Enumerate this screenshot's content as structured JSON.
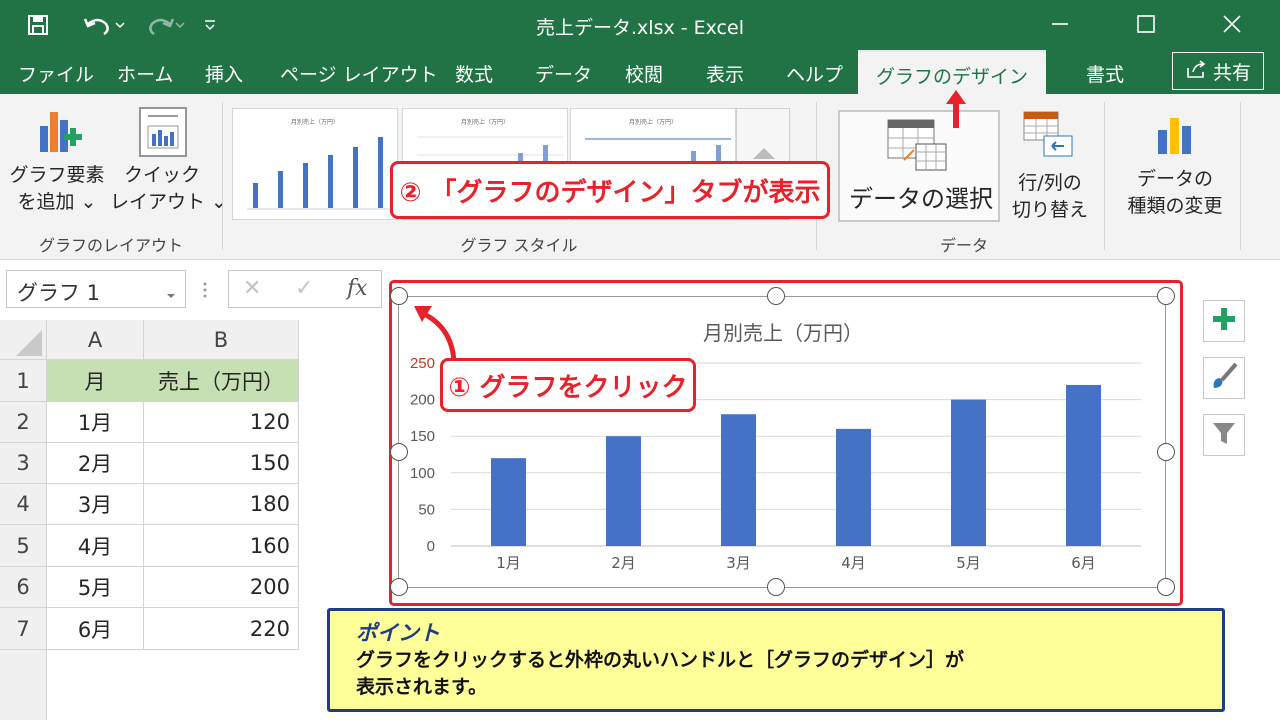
{
  "window": {
    "title": "売上データ.xlsx  -  Excel",
    "minimize_icon": "minimize-icon",
    "maximize_icon": "maximize-icon",
    "close_icon": "close-icon"
  },
  "tabs": [
    "ファイル",
    "ホーム",
    "挿入",
    "ページ レイアウト",
    "数式",
    "データ",
    "校閲",
    "表示",
    "ヘルプ",
    "グラフのデザイン",
    "書式"
  ],
  "active_tab": "グラフのデザイン",
  "share_label": "共有",
  "ribbon": {
    "add_element": [
      "グラフ要素",
      "を追加 ⌄"
    ],
    "quick_layout": [
      "クイック",
      "レイアウト ⌄"
    ],
    "group_layout": "グラフのレイアウト",
    "group_styles": "グラフ スタイル",
    "select_data": "データの選択",
    "switch_rowcol": [
      "行/列の",
      "切り替え"
    ],
    "group_data": "データ",
    "change_type": [
      "データの",
      "種類の変更"
    ],
    "thumb_title": "月別売上（万円）"
  },
  "callouts": {
    "step1": "① グラフをクリック",
    "step2": "② 「グラフのデザイン」タブが表示"
  },
  "formula_bar": {
    "name_box": "グラフ 1",
    "cancel": "✕",
    "confirm": "✓",
    "fx": "fx"
  },
  "sheet": {
    "col_headers": [
      "A",
      "B"
    ],
    "rows": [
      {
        "num": "1",
        "a": "月",
        "b": "売上（万円）"
      },
      {
        "num": "2",
        "a": "1月",
        "b": "120"
      },
      {
        "num": "3",
        "a": "2月",
        "b": "150"
      },
      {
        "num": "4",
        "a": "3月",
        "b": "180"
      },
      {
        "num": "5",
        "a": "4月",
        "b": "160"
      },
      {
        "num": "6",
        "a": "5月",
        "b": "200"
      },
      {
        "num": "7",
        "a": "6月",
        "b": "220"
      }
    ]
  },
  "chart_data": {
    "type": "bar",
    "title": "月別売上（万円）",
    "categories": [
      "1月",
      "2月",
      "3月",
      "4月",
      "5月",
      "6月"
    ],
    "values": [
      120,
      150,
      180,
      160,
      200,
      220
    ],
    "ylim": [
      0,
      250
    ],
    "yticks": [
      "0",
      "50",
      "100",
      "150",
      "200",
      "250"
    ],
    "grid": true,
    "bar_color": "#4472c4",
    "xlabel": "",
    "ylabel": ""
  },
  "point": {
    "heading": "ポイント",
    "line1": "グラフをクリックすると外枠の丸いハンドルと［グラフのデザイン］が",
    "line2": "表示されます。"
  },
  "colors": {
    "excel_green": "#217346",
    "callout_red": "#e8212a",
    "point_blue": "#1f3c88",
    "point_bg": "#ffff99",
    "header_green": "#c6e0b4"
  }
}
